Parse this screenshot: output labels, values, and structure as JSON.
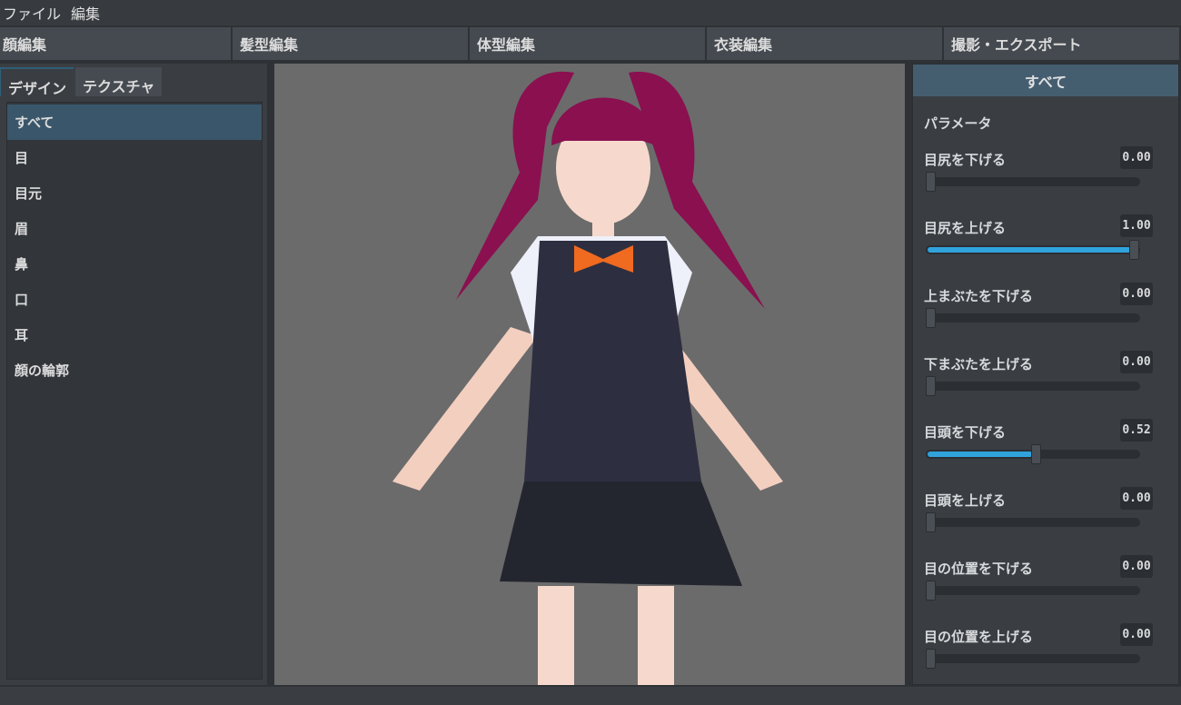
{
  "menu": [
    "ファイル",
    "編集"
  ],
  "main_tabs": [
    "顔編集",
    "髪型編集",
    "体型編集",
    "衣装編集",
    "撮影・エクスポート"
  ],
  "sub_tabs": [
    "デザイン",
    "テクスチャ"
  ],
  "categories": [
    "すべて",
    "目",
    "目元",
    "眉",
    "鼻",
    "口",
    "耳",
    "顔の輪郭"
  ],
  "selected_category": "すべて",
  "right_panel": {
    "header": "すべて",
    "section": "パラメータ",
    "params": [
      {
        "label": "目尻を下げる",
        "value": "0.00",
        "fraction": 0
      },
      {
        "label": "目尻を上げる",
        "value": "1.00",
        "fraction": 1
      },
      {
        "label": "上まぶたを下げる",
        "value": "0.00",
        "fraction": 0
      },
      {
        "label": "下まぶたを上げる",
        "value": "0.00",
        "fraction": 0
      },
      {
        "label": "目頭を下げる",
        "value": "0.52",
        "fraction": 0.52
      },
      {
        "label": "目頭を上げる",
        "value": "0.00",
        "fraction": 0
      },
      {
        "label": "目の位置を下げる",
        "value": "0.00",
        "fraction": 0
      },
      {
        "label": "目の位置を上げる",
        "value": "0.00",
        "fraction": 0
      }
    ]
  },
  "colors": {
    "accent": "#30a3dc",
    "selected": "#3a566a",
    "viewport": "#6b6b6b"
  }
}
